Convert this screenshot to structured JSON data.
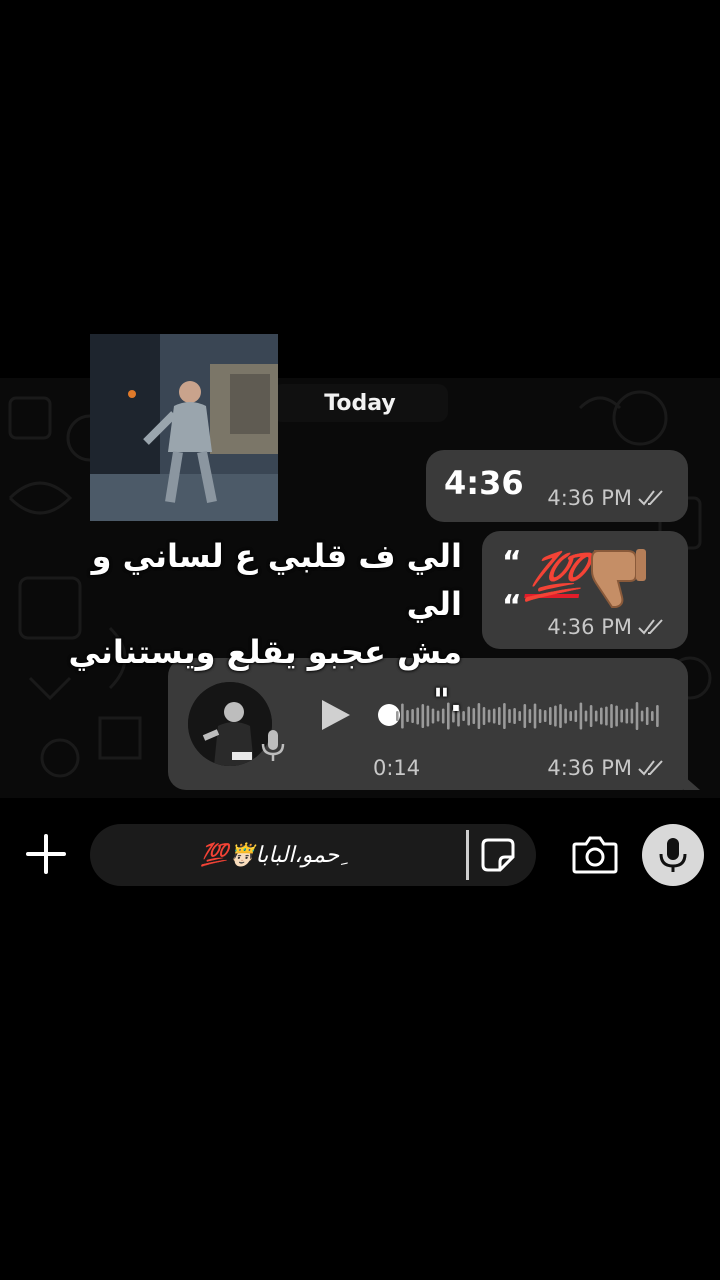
{
  "chat": {
    "date_divider": "Today",
    "messages": [
      {
        "text": "4:36",
        "time": "4:36 PM"
      },
      {
        "quote_open": "“",
        "quote_close": "“",
        "emoji_hundred": "💯",
        "emoji_thumb": "thumbs-down-icon",
        "time": "4:36 PM"
      },
      {
        "type": "voice",
        "duration": "0:14",
        "time": "4:36 PM",
        "progress": 0
      }
    ],
    "caption_line1": "الي ف قلبي ع لساني و الي",
    "caption_line2": "مش عجبو يقلع ويستناني .\""
  },
  "input": {
    "text": "ِحمو،البابا🤴🏻💯",
    "icons": [
      "plus-icon",
      "sticker-icon",
      "camera-icon",
      "mic-icon"
    ]
  },
  "colors": {
    "background": "#000000",
    "bubble": "#3a3a3a",
    "hundred_red": "#e11d2a",
    "meta_text": "#c8c8c8"
  }
}
